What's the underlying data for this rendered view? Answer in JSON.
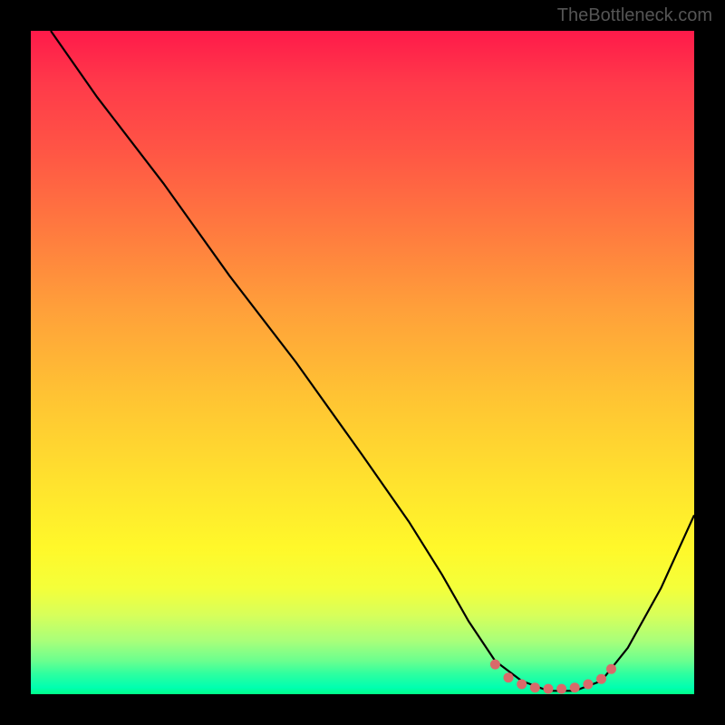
{
  "watermark": "TheBottleneck.com",
  "chart_data": {
    "type": "line",
    "title": "",
    "xlabel": "",
    "ylabel": "",
    "xlim": [
      0,
      100
    ],
    "ylim": [
      0,
      100
    ],
    "series": [
      {
        "name": "curve",
        "color": "#000000",
        "x": [
          3,
          10,
          20,
          30,
          40,
          50,
          57,
          62,
          66,
          70,
          74,
          78,
          82,
          86,
          90,
          95,
          100
        ],
        "y": [
          100,
          90,
          77,
          63,
          50,
          36,
          26,
          18,
          11,
          5,
          2,
          0.5,
          0.5,
          2,
          7,
          16,
          27
        ]
      }
    ],
    "markers": {
      "name": "minimum-flat",
      "color": "#d96a6a",
      "points": [
        {
          "x": 70,
          "y": 4.5
        },
        {
          "x": 72,
          "y": 2.5
        },
        {
          "x": 74,
          "y": 1.5
        },
        {
          "x": 76,
          "y": 1.0
        },
        {
          "x": 78,
          "y": 0.8
        },
        {
          "x": 80,
          "y": 0.8
        },
        {
          "x": 82,
          "y": 1.0
        },
        {
          "x": 84,
          "y": 1.5
        },
        {
          "x": 86,
          "y": 2.3
        },
        {
          "x": 87.5,
          "y": 3.8
        }
      ]
    },
    "grid": false,
    "legend": false
  }
}
